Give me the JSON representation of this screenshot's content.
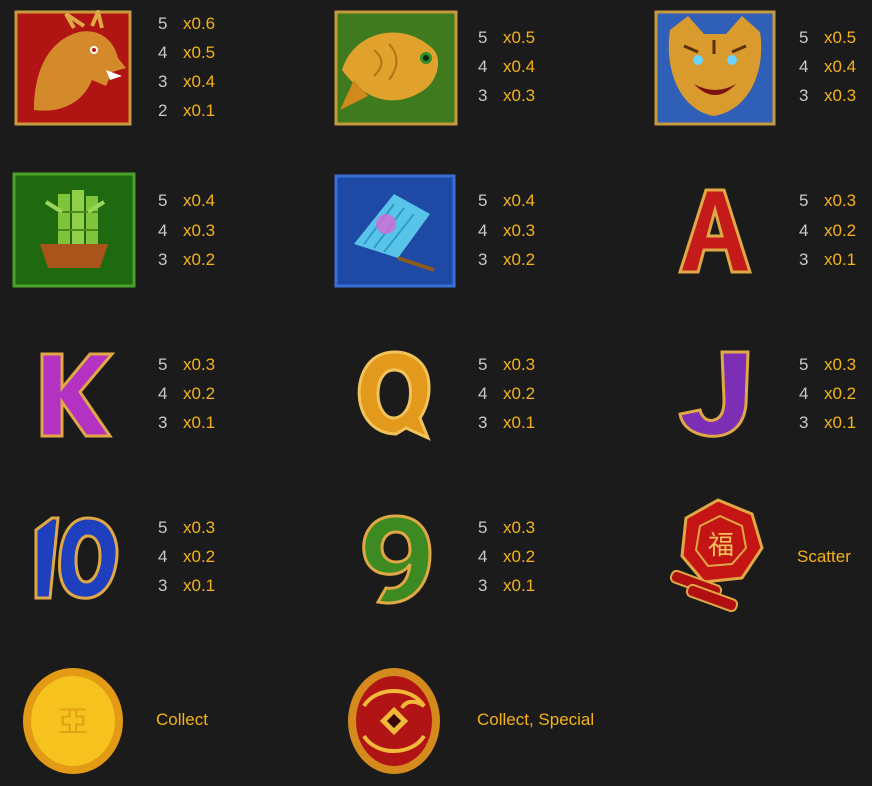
{
  "colors": {
    "background": "#1b1b1b",
    "multiplier": "#f5b318",
    "count": "#c9c9c9",
    "label": "#f5b318"
  },
  "symbols": [
    {
      "id": "dragon",
      "icon": "dragon-icon",
      "pays": [
        {
          "count": "5",
          "mult": "x0.6"
        },
        {
          "count": "4",
          "mult": "x0.5"
        },
        {
          "count": "3",
          "mult": "x0.4"
        },
        {
          "count": "2",
          "mult": "x0.1"
        }
      ]
    },
    {
      "id": "koi",
      "icon": "koi-fish-icon",
      "pays": [
        {
          "count": "5",
          "mult": "x0.5"
        },
        {
          "count": "4",
          "mult": "x0.4"
        },
        {
          "count": "3",
          "mult": "x0.3"
        }
      ]
    },
    {
      "id": "tiger",
      "icon": "tiger-icon",
      "pays": [
        {
          "count": "5",
          "mult": "x0.5"
        },
        {
          "count": "4",
          "mult": "x0.4"
        },
        {
          "count": "3",
          "mult": "x0.3"
        }
      ]
    },
    {
      "id": "bamboo",
      "icon": "bamboo-icon",
      "pays": [
        {
          "count": "5",
          "mult": "x0.4"
        },
        {
          "count": "4",
          "mult": "x0.3"
        },
        {
          "count": "3",
          "mult": "x0.2"
        }
      ]
    },
    {
      "id": "fan",
      "icon": "fan-icon",
      "pays": [
        {
          "count": "5",
          "mult": "x0.4"
        },
        {
          "count": "4",
          "mult": "x0.3"
        },
        {
          "count": "3",
          "mult": "x0.2"
        }
      ]
    },
    {
      "id": "ace",
      "icon": "letter-a-icon",
      "glyph": "A",
      "pays": [
        {
          "count": "5",
          "mult": "x0.3"
        },
        {
          "count": "4",
          "mult": "x0.2"
        },
        {
          "count": "3",
          "mult": "x0.1"
        }
      ]
    },
    {
      "id": "king",
      "icon": "letter-k-icon",
      "glyph": "K",
      "pays": [
        {
          "count": "5",
          "mult": "x0.3"
        },
        {
          "count": "4",
          "mult": "x0.2"
        },
        {
          "count": "3",
          "mult": "x0.1"
        }
      ]
    },
    {
      "id": "queen",
      "icon": "letter-q-icon",
      "glyph": "Q",
      "pays": [
        {
          "count": "5",
          "mult": "x0.3"
        },
        {
          "count": "4",
          "mult": "x0.2"
        },
        {
          "count": "3",
          "mult": "x0.1"
        }
      ]
    },
    {
      "id": "jack",
      "icon": "letter-j-icon",
      "glyph": "J",
      "pays": [
        {
          "count": "5",
          "mult": "x0.3"
        },
        {
          "count": "4",
          "mult": "x0.2"
        },
        {
          "count": "3",
          "mult": "x0.1"
        }
      ]
    },
    {
      "id": "ten",
      "icon": "number-10-icon",
      "glyph": "10",
      "pays": [
        {
          "count": "5",
          "mult": "x0.3"
        },
        {
          "count": "4",
          "mult": "x0.2"
        },
        {
          "count": "3",
          "mult": "x0.1"
        }
      ]
    },
    {
      "id": "nine",
      "icon": "number-9-icon",
      "glyph": "9",
      "pays": [
        {
          "count": "5",
          "mult": "x0.3"
        },
        {
          "count": "4",
          "mult": "x0.2"
        },
        {
          "count": "3",
          "mult": "x0.1"
        }
      ]
    }
  ],
  "specials": {
    "scatter": {
      "icon": "firecracker-scatter-icon",
      "glyph": "福",
      "label": "Scatter"
    },
    "collect": {
      "icon": "gold-coin-icon",
      "glyph": "亞",
      "label": "Collect"
    },
    "collect_special": {
      "icon": "red-dragon-coin-icon",
      "label": "Collect, Special"
    }
  }
}
